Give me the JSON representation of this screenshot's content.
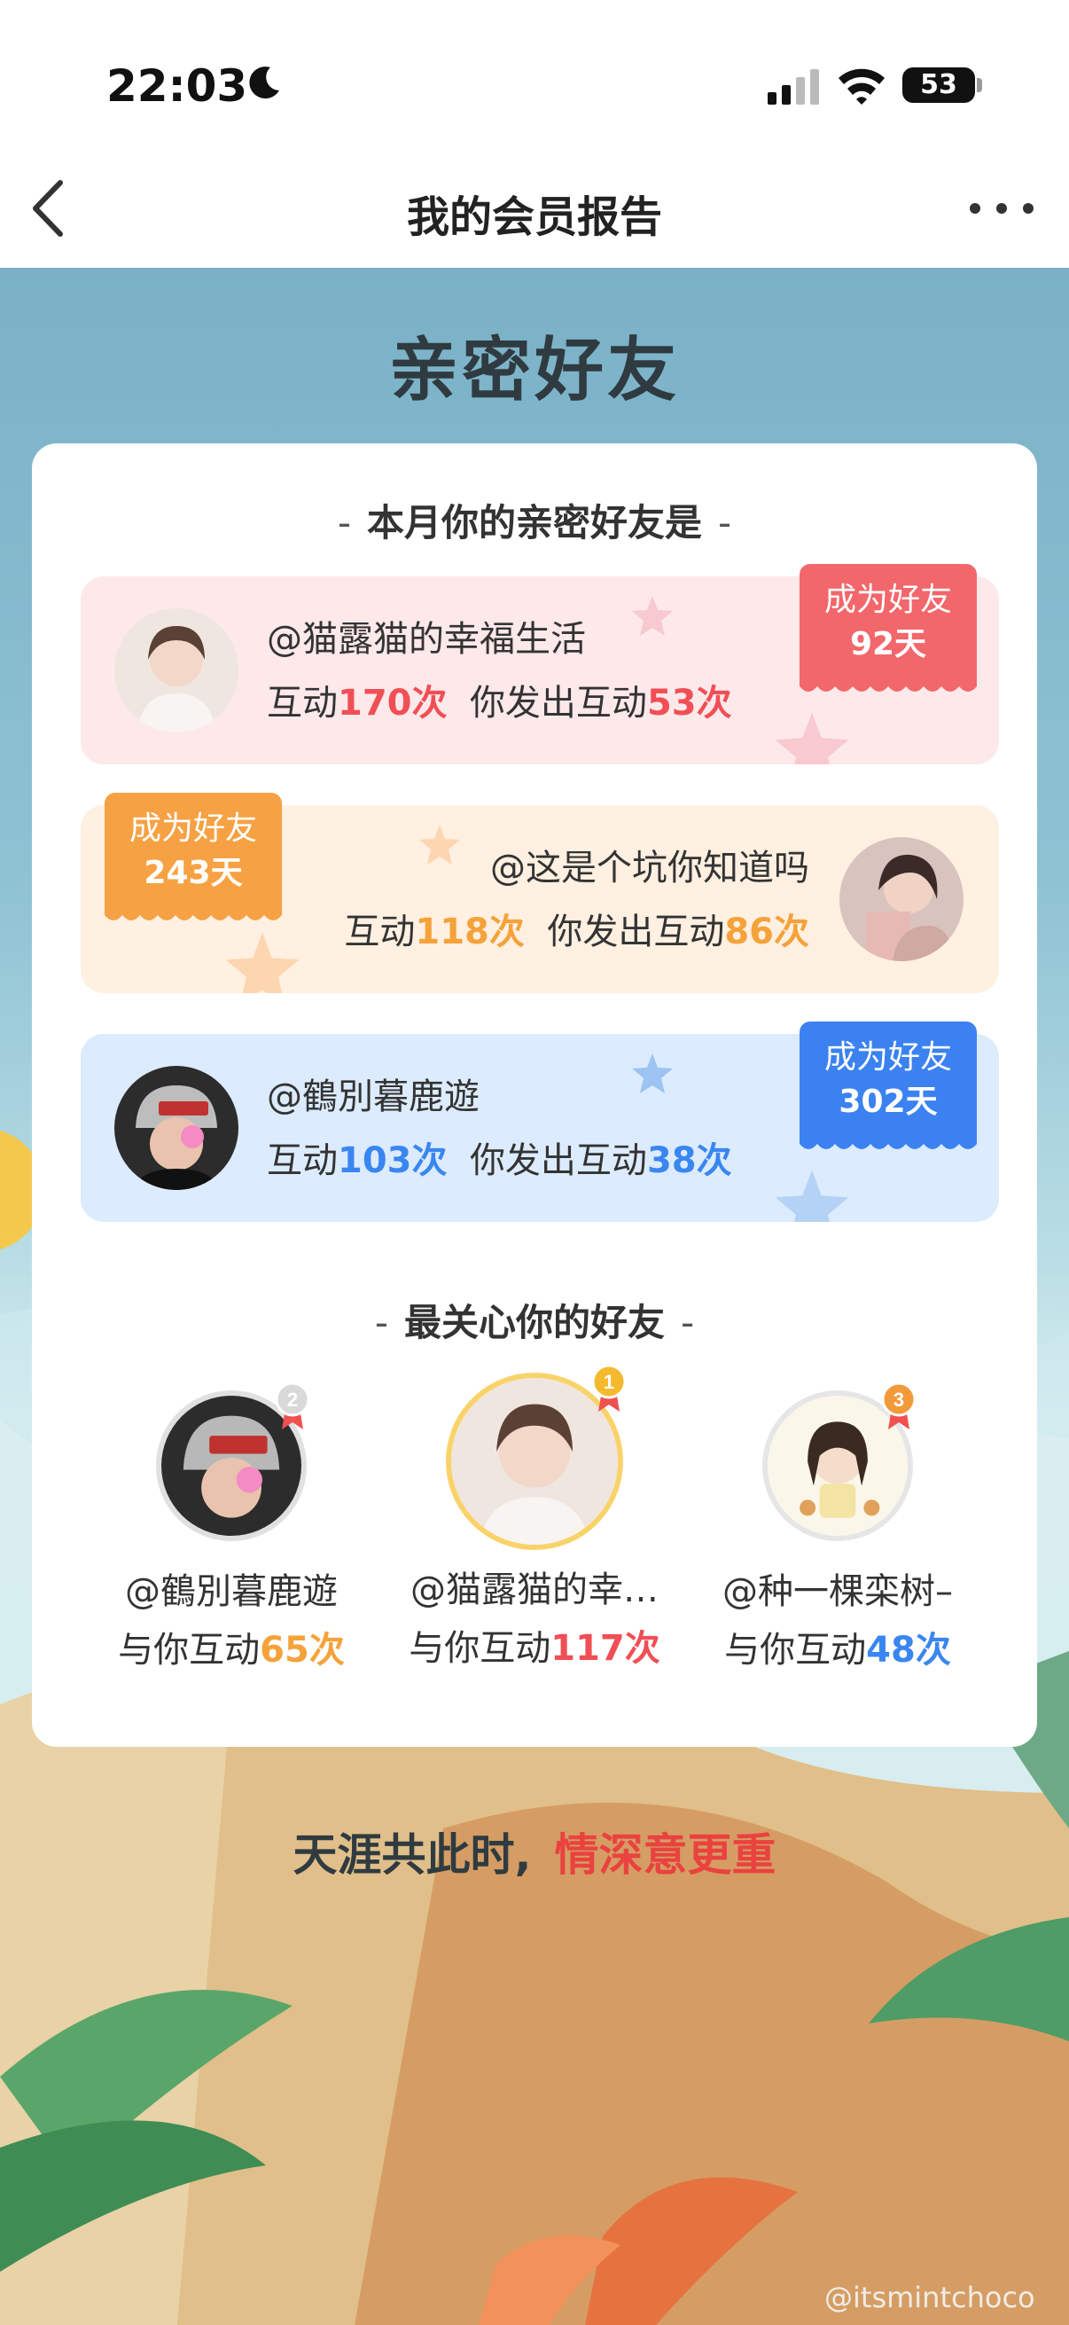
{
  "status": {
    "time": "22:03",
    "battery": "53"
  },
  "nav": {
    "title": "我的会员报告"
  },
  "section": {
    "title": "亲密好友"
  },
  "close_friends": {
    "heading": "本月你的亲密好友是",
    "items": [
      {
        "handle": "@猫露猫的幸福生活",
        "label_interact": "互动",
        "interactions": "170次",
        "label_sent": "你发出互动",
        "sent": "53次",
        "badge_label": "成为好友",
        "badge_days": "92天",
        "color": "#f2676b"
      },
      {
        "handle": "@这是个坑你知道吗",
        "label_interact": "互动",
        "interactions": "118次",
        "label_sent": "你发出互动",
        "sent": "86次",
        "badge_label": "成为好友",
        "badge_days": "243天",
        "color": "#f6a244"
      },
      {
        "handle": "@鶴別暮鹿遊",
        "label_interact": "互动",
        "interactions": "103次",
        "label_sent": "你发出互动",
        "sent": "38次",
        "badge_label": "成为好友",
        "badge_days": "302天",
        "color": "#3b82f0"
      }
    ]
  },
  "caring_friends": {
    "heading": "最关心你的好友",
    "items": [
      {
        "handle": "@鶴別暮鹿遊",
        "label": "与你互动",
        "count": "65次",
        "rank": "2"
      },
      {
        "handle": "@猫露猫的幸…",
        "label": "与你互动",
        "count": "117次",
        "rank": "1"
      },
      {
        "handle": "@种一棵栾树–",
        "label": "与你互动",
        "count": "48次",
        "rank": "3"
      }
    ]
  },
  "footer": {
    "text": "天涯共此时,",
    "accent": "情深意更重"
  },
  "watermark": "@itsmintchoco"
}
